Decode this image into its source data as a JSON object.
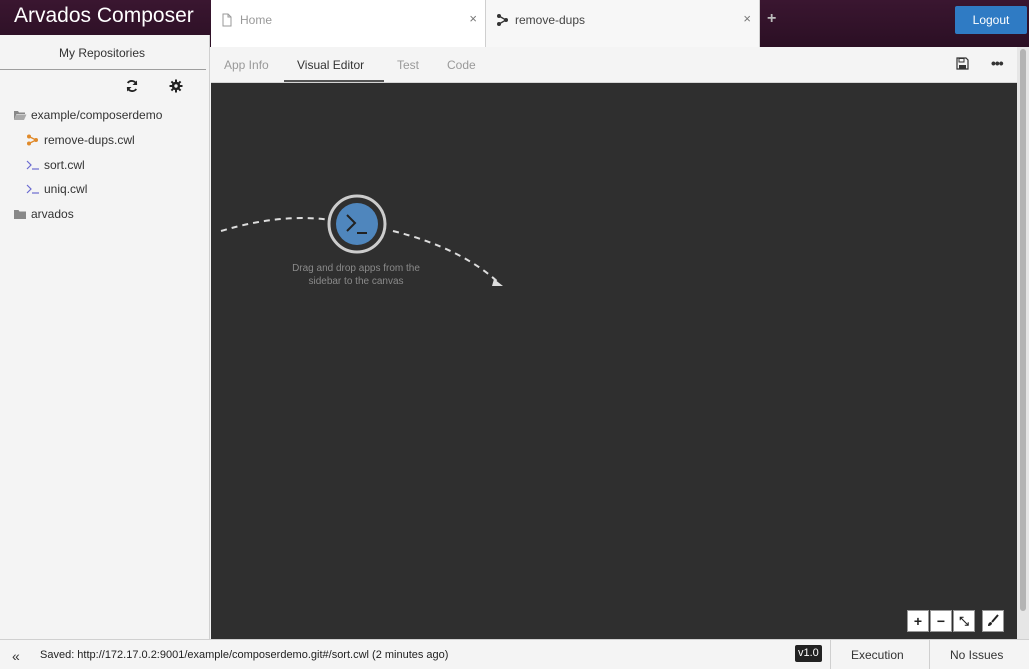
{
  "app": {
    "title": "Arvados Composer"
  },
  "tabs": [
    {
      "label": "Home",
      "icon": "file-icon",
      "close": "×"
    },
    {
      "label": "remove-dups",
      "icon": "workflow-icon",
      "close": "×"
    }
  ],
  "add_tab": "+",
  "logout_label": "Logout",
  "sidebar": {
    "title": "My Repositories",
    "tree": [
      {
        "label": "example/composerdemo",
        "icon": "folder-open-icon"
      },
      {
        "label": "remove-dups.cwl",
        "icon": "workflow-icon"
      },
      {
        "label": "sort.cwl",
        "icon": "terminal-icon"
      },
      {
        "label": "uniq.cwl",
        "icon": "terminal-icon"
      },
      {
        "label": "arvados",
        "icon": "folder-icon"
      }
    ]
  },
  "editor_tabs": [
    "App Info",
    "Visual Editor",
    "Test",
    "Code"
  ],
  "active_editor_tab": "Visual Editor",
  "canvas": {
    "hint": "Drag and drop apps from the sidebar to the canvas",
    "zoom_buttons": [
      {
        "icon": "zoom-in-icon",
        "glyph": "+"
      },
      {
        "icon": "zoom-out-icon",
        "glyph": "−"
      },
      {
        "icon": "fit-icon",
        "glyph": "⤡"
      },
      {
        "icon": "brush-icon",
        "glyph": "🖌"
      }
    ]
  },
  "status": {
    "collapse": "«",
    "text": "Saved: http://172.17.0.2:9001/example/composerdemo.git#/sort.cwl (2 minutes ago)",
    "version": "v1.0",
    "execution": "Execution",
    "issues": "No Issues"
  },
  "colors": {
    "header_bg": "#2b0f24",
    "logout_bg": "#2f7bc4",
    "canvas_bg": "#2f2f2f",
    "node_fill": "#4f86bd",
    "workflow_icon": "#e08a2a",
    "terminal_icon": "#6a6ad0"
  }
}
